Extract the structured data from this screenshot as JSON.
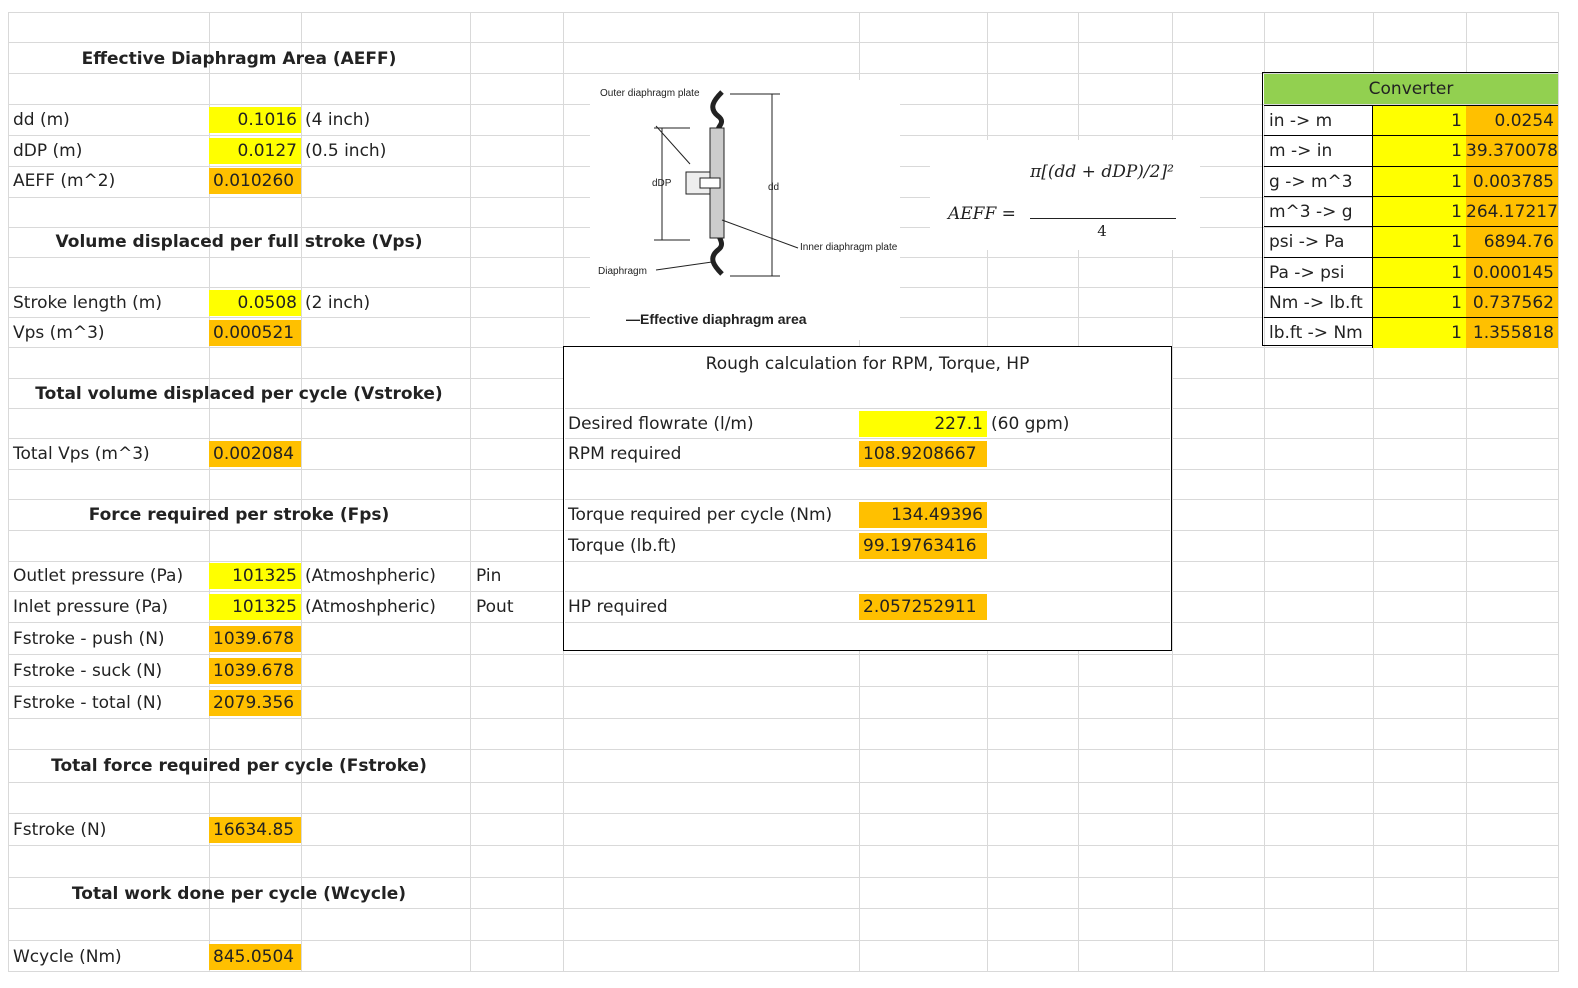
{
  "sections": {
    "aeff_title": "Effective Diaphragm Area (AEFF)",
    "vps_title": "Volume displaced per full stroke (Vps)",
    "vstroke_title": "Total volume displaced per cycle (Vstroke)",
    "fps_title": "Force required per stroke (Fps)",
    "fstroke_title": "Total force required per cycle (Fstroke)",
    "wcycle_title": "Total work done per cycle (Wcycle)"
  },
  "rows": {
    "dd": {
      "label": "dd (m)",
      "value": "0.1016",
      "note": "(4 inch)"
    },
    "ddp": {
      "label": "dDP  (m)",
      "value": "0.0127",
      "note": "(0.5 inch)"
    },
    "aeff": {
      "label": "AEFF (m^2)",
      "value": "0.010260"
    },
    "stroke_len": {
      "label": "Stroke length (m)",
      "value": "0.0508",
      "note": "(2 inch)"
    },
    "vps": {
      "label": "Vps (m^3)",
      "value": "0.000521"
    },
    "total_vps": {
      "label": "Total Vps (m^3)",
      "value": "0.002084"
    },
    "outlet": {
      "label": "Outlet pressure (Pa)",
      "value": "101325",
      "note": "(Atmoshpheric)",
      "extra": "Pin"
    },
    "inlet": {
      "label": "Inlet pressure (Pa)",
      "value": "101325",
      "note": "(Atmoshpheric)",
      "extra": "Pout"
    },
    "push": {
      "label": "Fstroke - push (N)",
      "value": "1039.678"
    },
    "suck": {
      "label": "Fstroke - suck (N)",
      "value": "1039.678"
    },
    "total": {
      "label": "Fstroke - total (N)",
      "value": "2079.356"
    },
    "fstroke": {
      "label": "Fstroke (N)",
      "value": "16634.85"
    },
    "wcycle": {
      "label": "Wcycle (Nm)",
      "value": "845.0504"
    }
  },
  "figure": {
    "outer_label": "Outer diaphragm plate",
    "ddp_label": "dDP",
    "dd_label": "dd",
    "inner_label": "Inner diaphragm plate",
    "diaphragm_label": "Diaphragm",
    "caption": "—Effective diaphragm area",
    "formula_lhs": "AEFF =",
    "formula_num": "π[(dd + dDP)/2]²",
    "formula_den": "4"
  },
  "rough": {
    "title": "Rough calculation for RPM, Torque, HP",
    "flow_label": "Desired flowrate (l/m)",
    "flow_value": "227.1",
    "flow_note": "(60 gpm)",
    "rpm_label": "RPM required",
    "rpm_value": "108.9208667",
    "torque_nm_label": "Torque required per cycle (Nm)",
    "torque_nm_value": "134.49396",
    "torque_lbft_label": "Torque (lb.ft)",
    "torque_lbft_value": "99.19763416",
    "hp_label": "HP required",
    "hp_value": "2.057252911"
  },
  "converter": {
    "title": "Converter",
    "rows": [
      {
        "label": "in -> m",
        "one": "1",
        "value": "0.0254"
      },
      {
        "label": "m -> in",
        "one": "1",
        "value": "39.370078"
      },
      {
        "label": "g -> m^3",
        "one": "1",
        "value": "0.003785"
      },
      {
        "label": "m^3 -> g",
        "one": "1",
        "value": "264.17217"
      },
      {
        "label": "psi -> Pa",
        "one": "1",
        "value": "6894.76"
      },
      {
        "label": "Pa -> psi",
        "one": "1",
        "value": "0.000145"
      },
      {
        "label": "Nm -> lb.ft",
        "one": "1",
        "value": "0.737562"
      },
      {
        "label": "lb.ft -> Nm",
        "one": "1",
        "value": "1.355818"
      }
    ]
  },
  "colors": {
    "input": "#ffff00",
    "output": "#ffc000",
    "converter_header": "#92d050"
  }
}
